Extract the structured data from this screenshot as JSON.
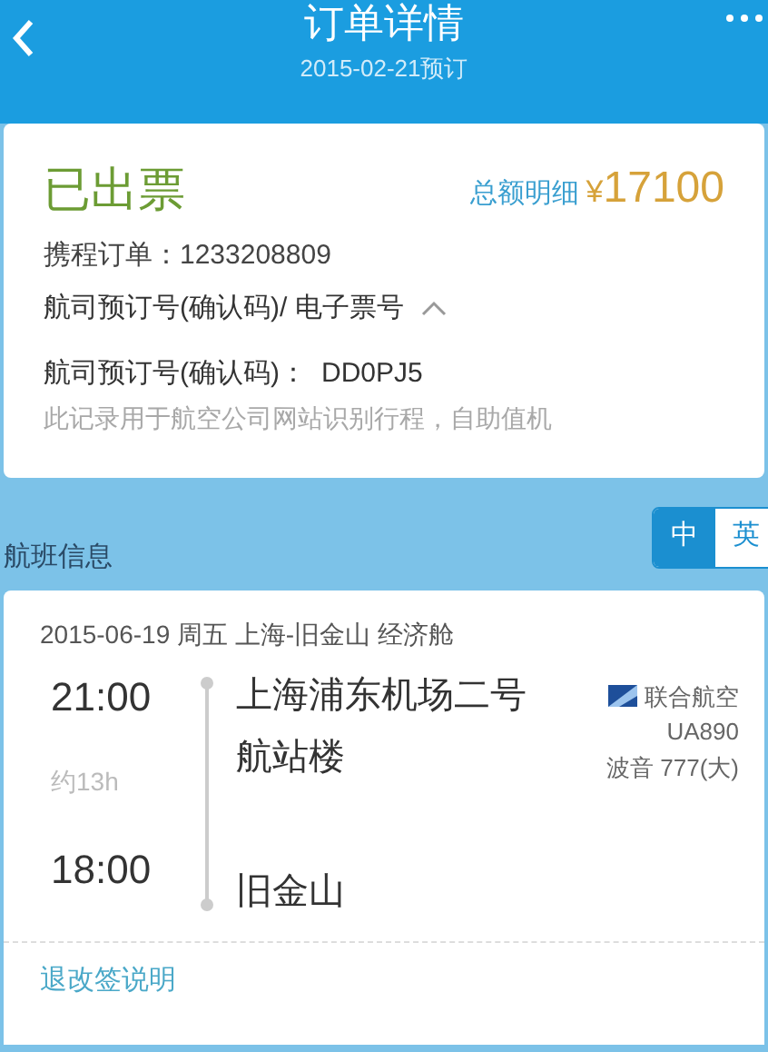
{
  "header": {
    "title": "订单详情",
    "subtitle": "2015-02-21预订"
  },
  "order": {
    "status": "已出票",
    "total_label": "总额明细",
    "currency": "¥",
    "total": "17100",
    "order_label": "携程订单：",
    "order_number": "1233208809",
    "section_title": "航司预订号(确认码)/ 电子票号",
    "expanded": true,
    "pnr_label": "航司预订号(确认码)：",
    "pnr": "DD0PJ5",
    "note": "此记录用于航空公司网站识别行程，自助值机"
  },
  "flight_section": {
    "title": "航班信息",
    "languages": [
      {
        "label": "中",
        "selected": true
      },
      {
        "label": "英",
        "selected": false
      }
    ]
  },
  "flight": {
    "summary": "2015-06-19 周五  上海-旧金山  经济舱",
    "depart_time": "21:00",
    "depart_place": "上海浦东机场二号航站楼",
    "duration": "约13h",
    "arrive_time": "18:00",
    "arrive_place": "旧金山",
    "airline": "联合航空",
    "flight_number": "UA890",
    "aircraft": "波音 777(大)"
  },
  "footer_link": "退改签说明"
}
